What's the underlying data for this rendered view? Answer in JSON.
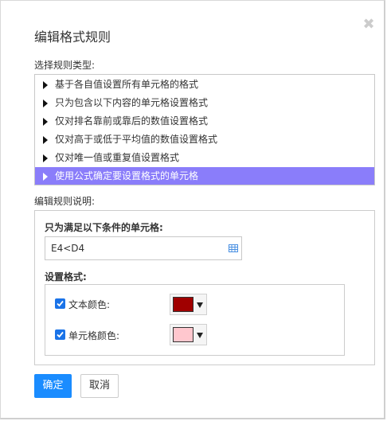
{
  "dialog": {
    "title": "编辑格式规则",
    "close_glyph": "✖",
    "select_type_label": "选择规则类型:",
    "rule_types": [
      {
        "label": "基于各自值设置所有单元格的格式",
        "selected": false
      },
      {
        "label": "只为包含以下内容的单元格设置格式",
        "selected": false
      },
      {
        "label": "仅对排名靠前或靠后的数值设置格式",
        "selected": false
      },
      {
        "label": "仅对高于或低于平均值的数值设置格式",
        "selected": false
      },
      {
        "label": "仅对唯一值或重复值设置格式",
        "selected": false
      },
      {
        "label": "使用公式确定要设置格式的单元格",
        "selected": true
      }
    ],
    "edit_desc_label": "编辑规则说明:",
    "condition_label": "只为满足以下条件的单元格:",
    "formula_value": "E4<D4",
    "format_label": "设置格式:",
    "text_color": {
      "label": "文本颜色:",
      "checked": true,
      "color": "#a00000"
    },
    "cell_color": {
      "label": "单元格颜色:",
      "checked": true,
      "color": "#ffc7ce"
    },
    "ok_label": "确定",
    "cancel_label": "取消",
    "accent_color": "#1a8cff",
    "selection_color": "#8a7dfa"
  }
}
